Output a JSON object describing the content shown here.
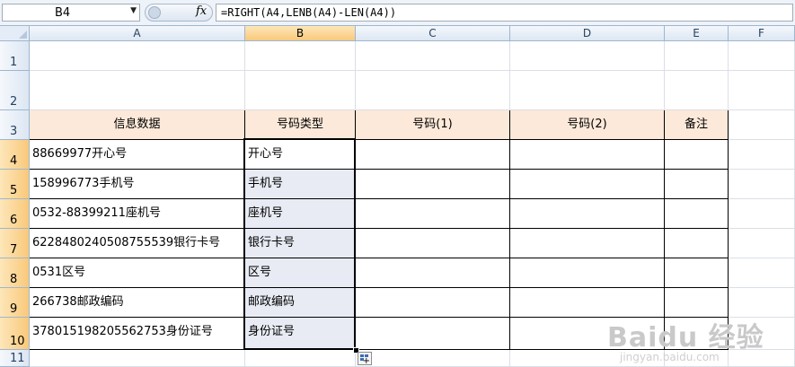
{
  "formula_bar": {
    "name_box": "B4",
    "fx_label": "fx",
    "formula": "=RIGHT(A4,LENB(A4)-LEN(A4))"
  },
  "columns": [
    "A",
    "B",
    "C",
    "D",
    "E",
    "F"
  ],
  "rows": [
    "1",
    "2",
    "3",
    "4",
    "5",
    "6",
    "7",
    "8",
    "9",
    "10",
    "11"
  ],
  "table": {
    "headers": [
      "信息数据",
      "号码类型",
      "号码(1)",
      "号码(2)",
      "备注"
    ],
    "data": [
      [
        "88669977开心号",
        "开心号",
        "",
        "",
        ""
      ],
      [
        "158996773手机号",
        "手机号",
        "",
        "",
        ""
      ],
      [
        "0532-88399211座机号",
        "座机号",
        "",
        "",
        ""
      ],
      [
        "6228480240508755539银行卡号",
        "银行卡号",
        "",
        "",
        ""
      ],
      [
        "0531区号",
        "区号",
        "",
        "",
        ""
      ],
      [
        "266738邮政编码",
        "邮政编码",
        "",
        "",
        ""
      ],
      [
        "378015198205562753身份证号",
        "身份证号",
        "",
        "",
        ""
      ]
    ]
  },
  "watermark": {
    "main": "Baidu 经验",
    "sub": "jingyan.baidu.com"
  },
  "colors": {
    "header_fill": "#fde9d9",
    "selected_header": "#f9c97a",
    "selection_fill": "#e8ebf4"
  }
}
